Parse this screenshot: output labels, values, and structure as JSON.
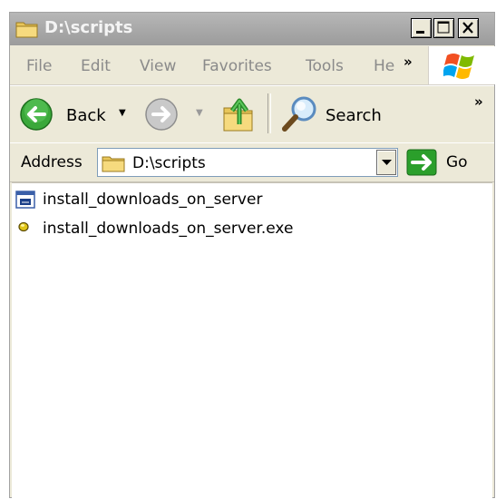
{
  "window": {
    "title": "D:\\scripts",
    "title_icon": "folder-icon"
  },
  "menu": {
    "items": [
      "File",
      "Edit",
      "View",
      "Favorites",
      "Tools",
      "He"
    ],
    "chevron": "»"
  },
  "toolbar": {
    "back_label": "Back",
    "search_label": "Search",
    "chevron": "»"
  },
  "address": {
    "label": "Address",
    "value": "D:\\scripts",
    "go_label": "Go"
  },
  "files": [
    {
      "name": "install_downloads_on_server",
      "icon": "script-window-icon"
    },
    {
      "name": "install_downloads_on_server.exe",
      "icon": "exe-dot-icon"
    }
  ],
  "colors": {
    "title_bar": "#a6a6a6",
    "chrome": "#ece9d8",
    "go_green": "#2b9f2b",
    "back_green": "#3aa83a"
  }
}
